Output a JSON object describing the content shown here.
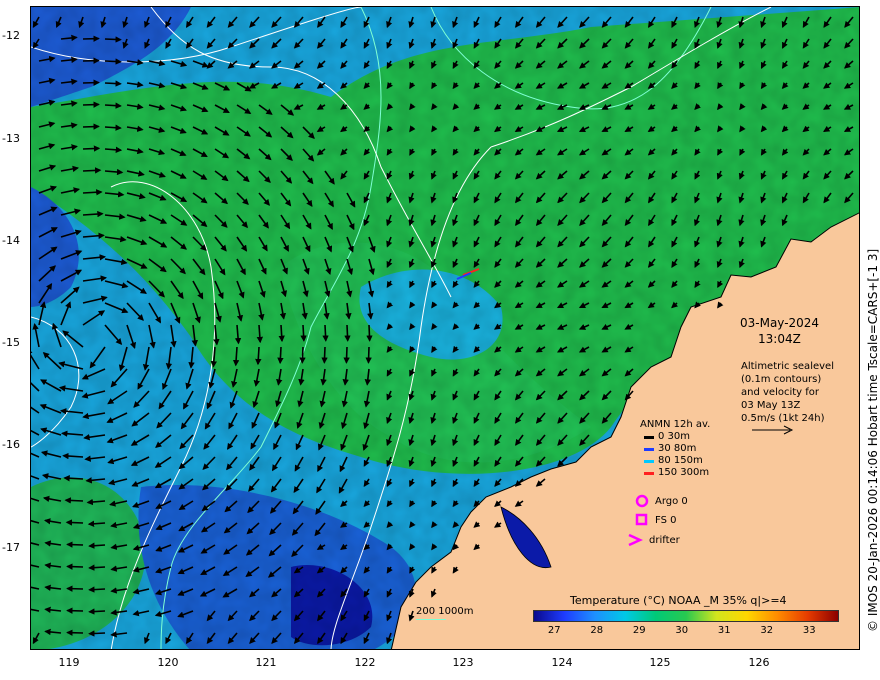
{
  "lat_ticks": [
    "-12",
    "-13",
    "-14",
    "-15",
    "-16",
    "-17"
  ],
  "lon_ticks": [
    "119",
    "120",
    "121",
    "122",
    "123",
    "124",
    "125",
    "126"
  ],
  "date": "03-May-2024",
  "time": "13:04Z",
  "description": [
    "Altimetric sealevel",
    "(0.1m contours)",
    "and velocity for",
    "03 May 13Z",
    "0.5m/s (1kt 24h)"
  ],
  "depth_legend": {
    "title": "ANMN 12h av.",
    "rows": [
      {
        "label": "0 30m",
        "color": "#000000"
      },
      {
        "label": "30 80m",
        "color": "#1e3cff"
      },
      {
        "label": "80 150m",
        "color": "#00c8ff"
      },
      {
        "label": "150 300m",
        "color": "#ff2020"
      }
    ]
  },
  "markers": {
    "argo": "Argo 0",
    "fs": "FS 0",
    "drifter": "drifter",
    "color": "#ff00ff"
  },
  "colorbar": {
    "title": "Temperature (°C) NOAA _M 35% q|>=4",
    "ticks": [
      "27",
      "28",
      "29",
      "30",
      "31",
      "32",
      "33"
    ],
    "min": 26.5,
    "max": 33.7,
    "stops": [
      "#0a0a8c",
      "#1e3cff",
      "#1e90ff",
      "#00c8e6",
      "#00c878",
      "#28c850",
      "#d2e61e",
      "#ffd700",
      "#ff8c00",
      "#e63c00",
      "#8c0000"
    ]
  },
  "contour_key": "200  1000m",
  "credit": "© IMOS 20-Jan-2026 00:14:06 Hobart time Tscale=CARS+[-1 3]",
  "colors": {
    "land": "#f9c89b",
    "sea_green": "#1fbf4c",
    "sea_cyan": "#15b0e8",
    "sea_blue": "#1d5cd6",
    "sea_deep": "#0b1aa8",
    "contour_200": "#7fffd4",
    "sealevel_contour": "#ffffff"
  },
  "map_extent": {
    "lon": [
      118.6,
      126.95
    ],
    "lat": [
      -17.95,
      -11.7
    ]
  }
}
